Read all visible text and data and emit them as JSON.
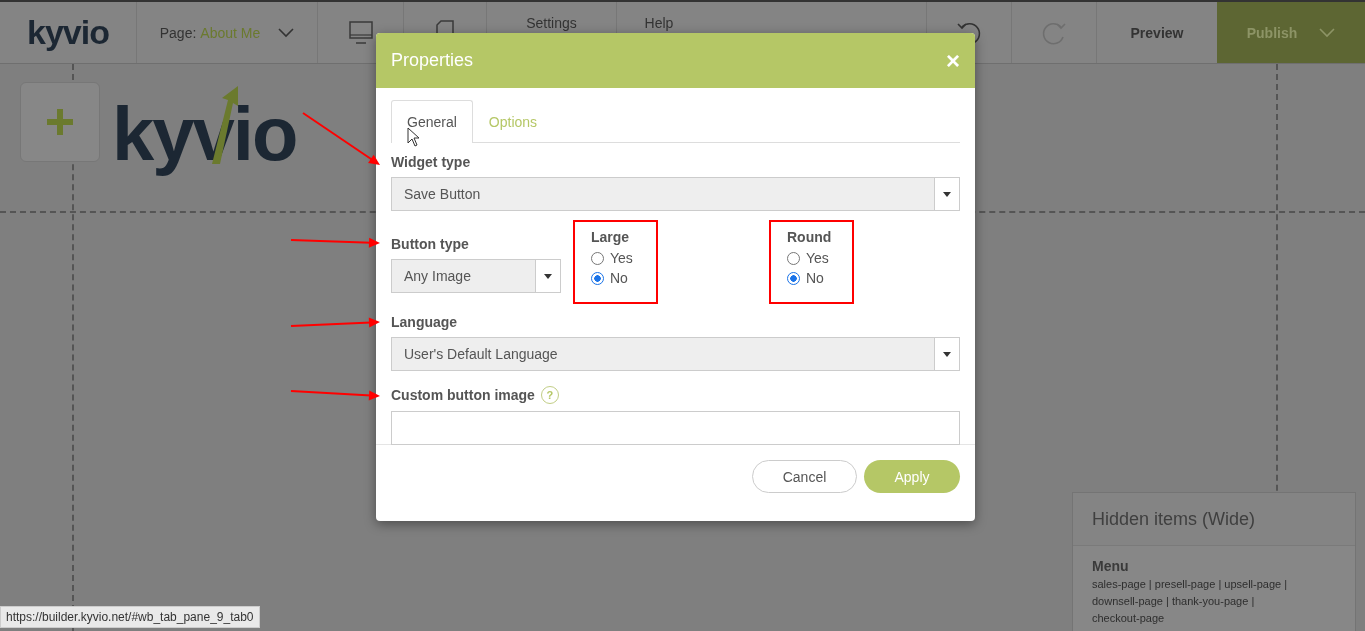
{
  "topbar": {
    "logo": "kyvio",
    "page_label": "Page:",
    "page_name": "About Me",
    "settings": "Settings",
    "help": "Help",
    "preview": "Preview",
    "publish": "Publish"
  },
  "canvas": {
    "logo": "kyvio"
  },
  "hidden_panel": {
    "title": "Hidden items (Wide)",
    "menu_title": "Menu",
    "menu_links": "sales-page | presell-page | upsell-page | downsell-page | thank-you-page | checkout-page"
  },
  "dialog": {
    "title": "Properties",
    "close": "×",
    "tabs": [
      {
        "label": "General",
        "selected": true
      },
      {
        "label": "Options",
        "selected": false
      }
    ],
    "widget_type": {
      "label": "Widget type",
      "value": "Save Button"
    },
    "button_type": {
      "label": "Button type",
      "value": "Any Image"
    },
    "large": {
      "label": "Large",
      "options": [
        {
          "label": "Yes",
          "selected": false
        },
        {
          "label": "No",
          "selected": true
        }
      ]
    },
    "round": {
      "label": "Round",
      "options": [
        {
          "label": "Yes",
          "selected": false
        },
        {
          "label": "No",
          "selected": true
        }
      ]
    },
    "language": {
      "label": "Language",
      "value": "User's Default Language"
    },
    "custom_image": {
      "label": "Custom button image",
      "help": "?"
    },
    "buttons": {
      "cancel": "Cancel",
      "apply": "Apply"
    }
  },
  "status_url": "https://builder.kyvio.net/#wb_tab_pane_9_tab0"
}
